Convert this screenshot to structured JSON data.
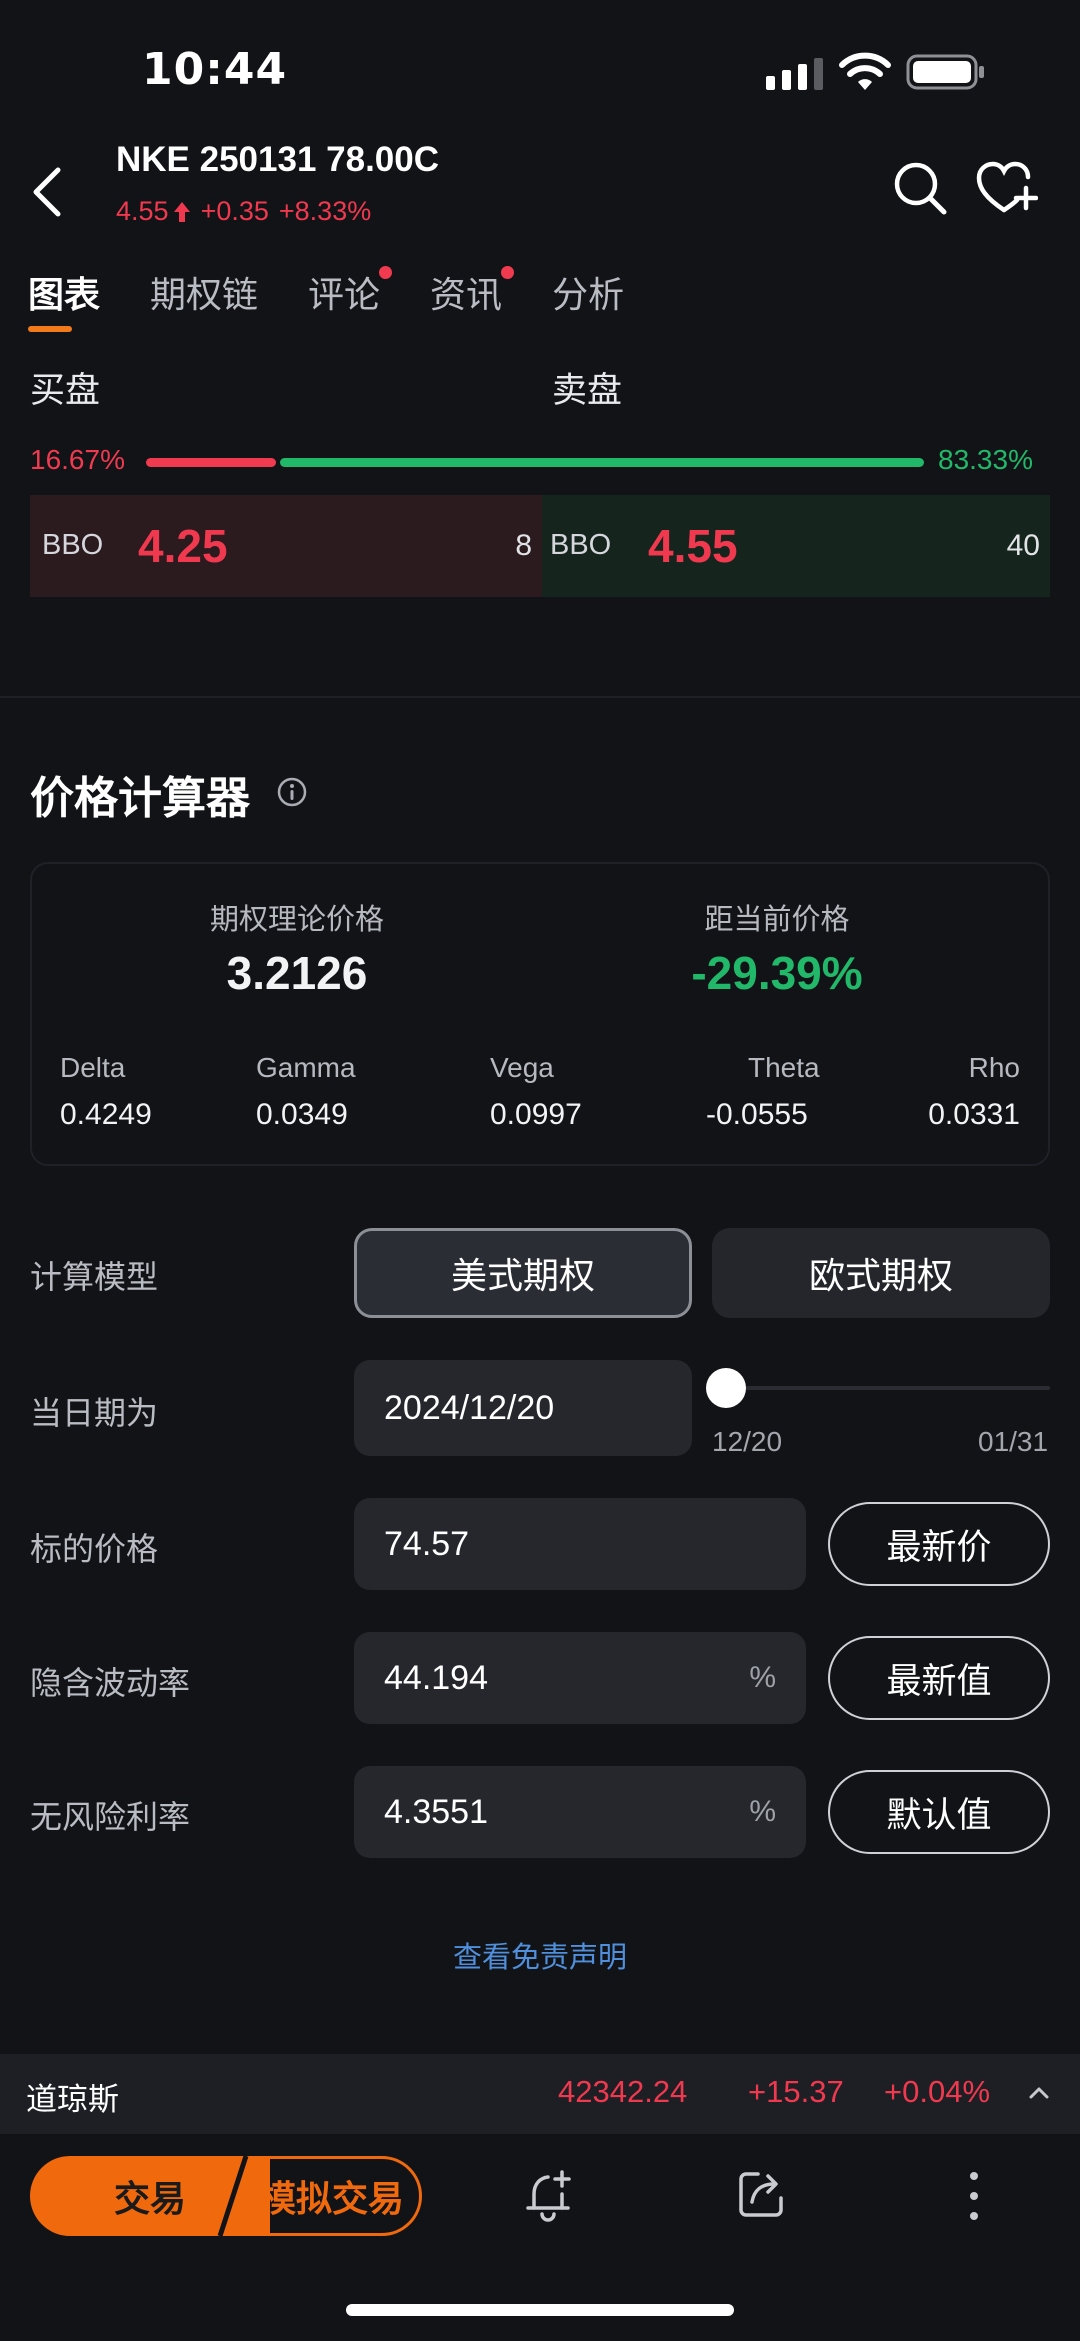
{
  "status_bar": {
    "time": "10:44"
  },
  "header": {
    "title": "NKE 250131 78.00C",
    "last_price": "4.55",
    "change": "+0.35",
    "change_pct": "+8.33%"
  },
  "tabs": [
    {
      "label": "图表",
      "active": true,
      "dot": false
    },
    {
      "label": "期权链",
      "active": false,
      "dot": false
    },
    {
      "label": "评论",
      "active": false,
      "dot": true
    },
    {
      "label": "资讯",
      "active": false,
      "dot": true
    },
    {
      "label": "分析",
      "active": false,
      "dot": false
    }
  ],
  "order_book": {
    "bid_label": "买盘",
    "ask_label": "卖盘",
    "bid_pct": "16.67%",
    "ask_pct": "83.33%",
    "bid_ratio": 0.1667,
    "bid": {
      "tag": "BBO",
      "price": "4.25",
      "size": "8"
    },
    "ask": {
      "tag": "BBO",
      "price": "4.55",
      "size": "40"
    }
  },
  "calculator": {
    "title": "价格计算器",
    "theoretical_label": "期权理论价格",
    "theoretical_value": "3.2126",
    "distance_label": "距当前价格",
    "distance_value": "-29.39%",
    "greeks": [
      {
        "name": "Delta",
        "value": "0.4249"
      },
      {
        "name": "Gamma",
        "value": "0.0349"
      },
      {
        "name": "Vega",
        "value": "0.0997"
      },
      {
        "name": "Theta",
        "value": "-0.0555"
      },
      {
        "name": "Rho",
        "value": "0.0331"
      }
    ],
    "model_label": "计算模型",
    "model_american": "美式期权",
    "model_european": "欧式期权",
    "date_label": "当日期为",
    "date_value": "2024/12/20",
    "slider_min": "12/20",
    "slider_max": "01/31",
    "underlying_label": "标的价格",
    "underlying_value": "74.57",
    "underlying_button": "最新价",
    "iv_label": "隐含波动率",
    "iv_value": "44.194",
    "iv_unit": "%",
    "iv_button": "最新值",
    "rate_label": "无风险利率",
    "rate_value": "4.3551",
    "rate_unit": "%",
    "rate_button": "默认值",
    "disclaimer": "查看免责声明"
  },
  "ticker": {
    "name": "道琼斯",
    "value": "42342.24",
    "change": "+15.37",
    "change_pct": "+0.04%"
  },
  "bottom_bar": {
    "trade_label": "交易",
    "sim_trade_label": "模拟交易"
  },
  "colors": {
    "up_red": "#f0394f",
    "down_green": "#22b86a",
    "accent_orange": "#f06a0d",
    "link_blue": "#4f8fdc"
  }
}
